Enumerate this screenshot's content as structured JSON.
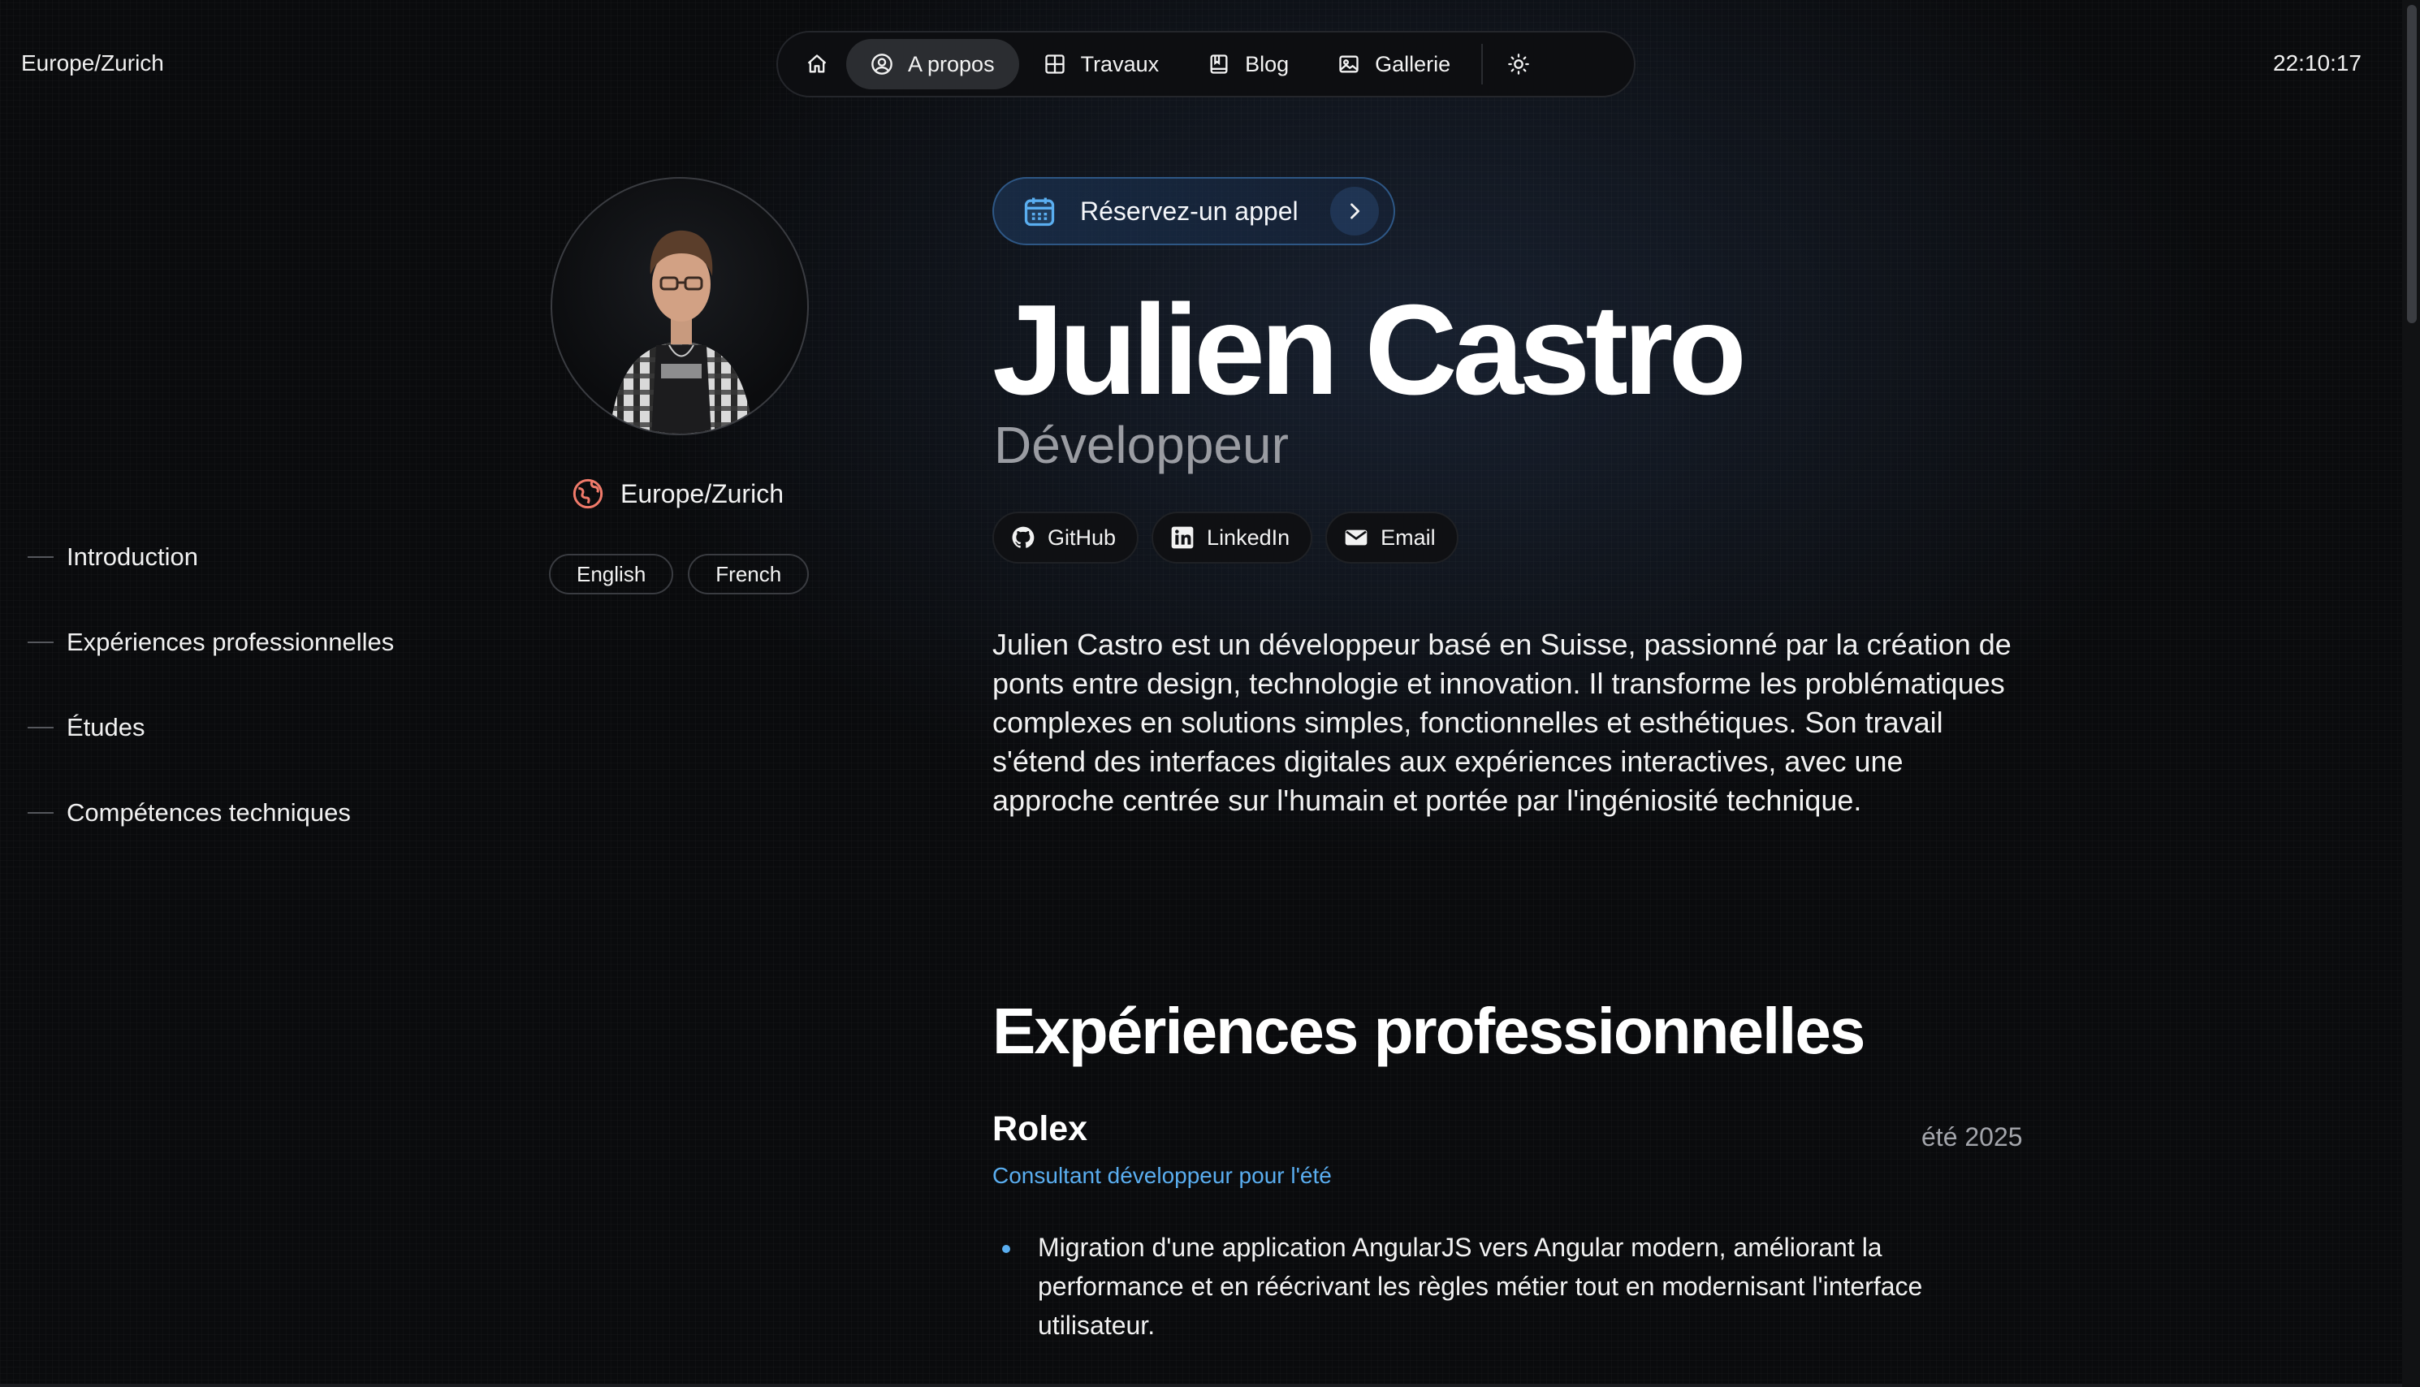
{
  "header": {
    "timezone": "Europe/Zurich",
    "clock": "22:10:17"
  },
  "nav": {
    "items": [
      {
        "label": "A propos",
        "icon": "user-circle-icon",
        "active": true
      },
      {
        "label": "Travaux",
        "icon": "grid-icon"
      },
      {
        "label": "Blog",
        "icon": "book-icon"
      },
      {
        "label": "Gallerie",
        "icon": "image-icon"
      }
    ],
    "home_icon": "home-icon",
    "theme_icon": "sun-icon"
  },
  "sidenav": {
    "items": [
      {
        "label": "Introduction"
      },
      {
        "label": "Expériences professionnelles"
      },
      {
        "label": "Études"
      },
      {
        "label": "Compétences techniques"
      }
    ]
  },
  "profile": {
    "location": "Europe/Zurich",
    "languages": [
      "English",
      "French"
    ]
  },
  "cta": {
    "book_call": "Réservez-un appel"
  },
  "hero": {
    "name": "Julien Castro",
    "role": "Développeur"
  },
  "socials": [
    {
      "label": "GitHub",
      "icon": "github-icon"
    },
    {
      "label": "LinkedIn",
      "icon": "linkedin-icon"
    },
    {
      "label": "Email",
      "icon": "email-icon"
    }
  ],
  "intro": "Julien Castro est un développeur basé en Suisse, passionné par la création de ponts entre design, technologie et innovation. Il transforme les problématiques complexes en solutions simples, fonctionnelles et esthétiques. Son travail s'étend des interfaces digitales aux expériences interactives, avec une approche centrée sur l'humain et portée par l'ingéniosité technique.",
  "experience": {
    "heading": "Expériences professionnelles",
    "jobs": [
      {
        "company": "Rolex",
        "period": "été 2025",
        "position": "Consultant développeur pour l'été",
        "bullets": [
          "Migration d'une application AngularJS vers Angular modern, améliorant la performance et en réécrivant les règles métier tout en modernisant l'interface utilisateur."
        ]
      }
    ]
  },
  "colors": {
    "background": "#0a0b0d",
    "accent": "#5aaef0",
    "muted": "#9a9ca2"
  }
}
